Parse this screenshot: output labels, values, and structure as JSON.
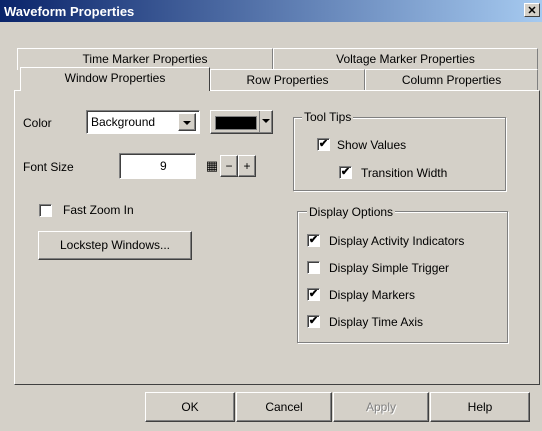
{
  "window": {
    "title": "Waveform Properties",
    "close_glyph": "✕"
  },
  "tabs": {
    "time_marker": "Time Marker Properties",
    "voltage_marker": "Voltage Marker Properties",
    "window": "Window Properties",
    "row": "Row Properties",
    "column": "Column Properties",
    "active": "Window Properties"
  },
  "color": {
    "label": "Color",
    "selected": "Background",
    "swatch": "#000000"
  },
  "font_size": {
    "label": "Font Size",
    "value": "9",
    "minus": "−",
    "plus": "+"
  },
  "fast_zoom": {
    "label": "Fast Zoom In",
    "checked": false
  },
  "lockstep_button": "Lockstep Windows...",
  "tool_tips": {
    "title": "Tool Tips",
    "show_values": {
      "label": "Show Values",
      "checked": true
    },
    "transition_width": {
      "label": "Transition Width",
      "checked": true
    }
  },
  "display_options": {
    "title": "Display Options",
    "items": [
      {
        "label": "Display Activity Indicators",
        "checked": true
      },
      {
        "label": "Display Simple Trigger",
        "checked": false
      },
      {
        "label": "Display Markers",
        "checked": true
      },
      {
        "label": "Display Time Axis",
        "checked": true
      }
    ]
  },
  "buttons": {
    "ok": "OK",
    "cancel": "Cancel",
    "apply": "Apply",
    "help": "Help"
  },
  "check_glyph": "✔"
}
